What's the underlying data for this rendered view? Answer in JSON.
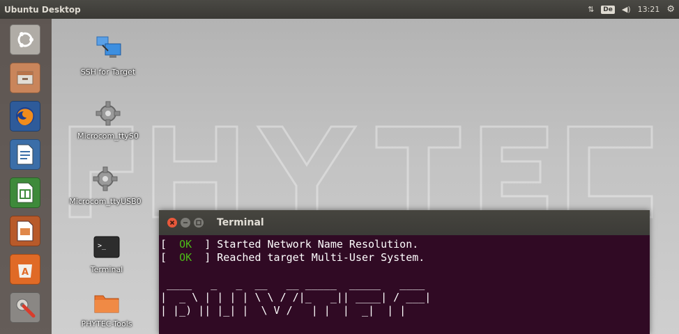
{
  "panel": {
    "title": "Ubuntu Desktop",
    "keyboard_layout": "De",
    "clock": "13:21"
  },
  "launcher": {
    "items": [
      {
        "name": "dash-home",
        "icon": "ubuntu-logo-icon"
      },
      {
        "name": "files",
        "icon": "files-icon"
      },
      {
        "name": "firefox",
        "icon": "firefox-icon"
      },
      {
        "name": "libreoffice-writer",
        "icon": "writer-icon"
      },
      {
        "name": "libreoffice-calc",
        "icon": "calc-icon"
      },
      {
        "name": "libreoffice-impress",
        "icon": "impress-icon"
      },
      {
        "name": "software-center",
        "icon": "software-center-icon"
      },
      {
        "name": "system-settings",
        "icon": "settings-icon"
      }
    ]
  },
  "desktop_icons": [
    {
      "label": "SSH for Target"
    },
    {
      "label": "Microcom_ttyS0"
    },
    {
      "label": "Microcom_ttyUSB0"
    },
    {
      "label": "Terminal"
    },
    {
      "label": "PHYTEC-Tools"
    }
  ],
  "terminal": {
    "title": "Terminal",
    "lines": [
      {
        "open": "[",
        "status": "  OK  ",
        "close": "] Started Network Name Resolution."
      },
      {
        "open": "[",
        "status": "  OK  ",
        "close": "] Reached target Multi-User System."
      }
    ],
    "ascii_art": " ____   _   _  __   __ _____  _____   ____\n|  _ \\ | | | | \\ \\ / /|_   _|| ____| / ___|\n| |_) || |_| |  \\ V /   | |  |  _|  | |"
  },
  "colors": {
    "terminal_bg": "#300a24",
    "ok_green": "#4cbb17",
    "close_button": "#e8583b",
    "panel_bg": "#3c3b37"
  }
}
